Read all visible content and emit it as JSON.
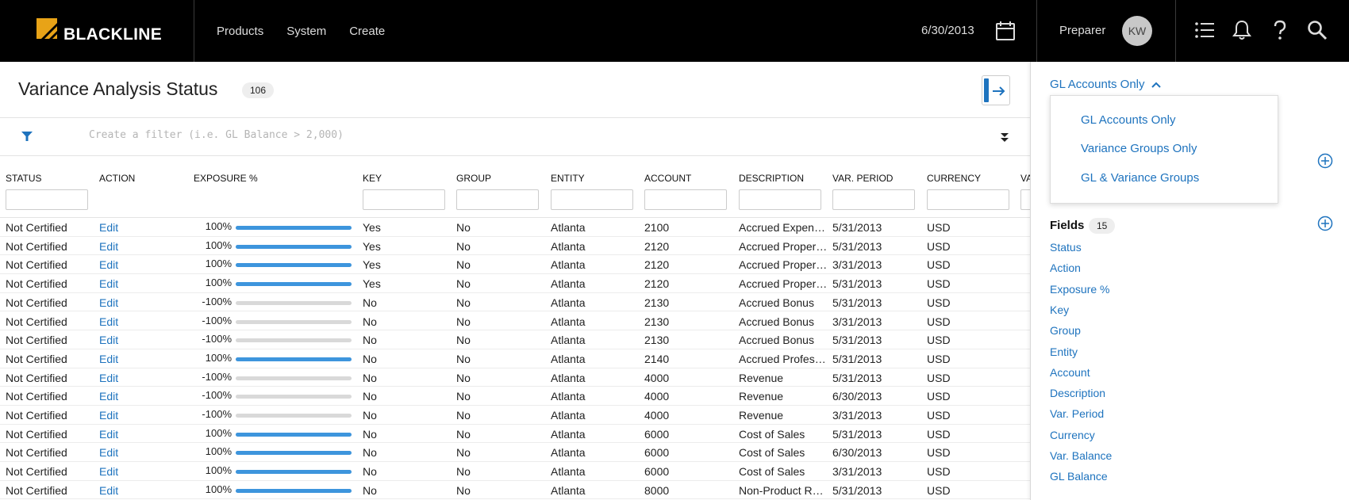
{
  "app": {
    "brand": "BLACKLINE",
    "accent": "#1e73be",
    "bar_blue": "#3d95dd",
    "logo_gold": "#e8a317"
  },
  "nav": {
    "items": [
      "Products",
      "System",
      "Create"
    ]
  },
  "header": {
    "period_date": "6/30/2013",
    "role": "Preparer",
    "avatar_initials": "KW"
  },
  "page": {
    "title": "Variance Analysis Status",
    "count": "106"
  },
  "filter": {
    "placeholder": "Create a filter (i.e. GL Balance > 2,000)"
  },
  "columns": [
    "STATUS",
    "ACTION",
    "EXPOSURE %",
    "KEY",
    "GROUP",
    "ENTITY",
    "ACCOUNT",
    "DESCRIPTION",
    "VAR. PERIOD",
    "CURRENCY",
    "VA"
  ],
  "rows": [
    {
      "status": "Not Certified",
      "action": "Edit",
      "exposure": "100%",
      "fill": 1,
      "key": "Yes",
      "group": "No",
      "entity": "Atlanta",
      "account": "2100",
      "description": "Accrued Expenses",
      "period": "5/31/2013",
      "currency": "USD"
    },
    {
      "status": "Not Certified",
      "action": "Edit",
      "exposure": "100%",
      "fill": 1,
      "key": "Yes",
      "group": "No",
      "entity": "Atlanta",
      "account": "2120",
      "description": "Accrued Property Tax",
      "period": "5/31/2013",
      "currency": "USD"
    },
    {
      "status": "Not Certified",
      "action": "Edit",
      "exposure": "100%",
      "fill": 1,
      "key": "Yes",
      "group": "No",
      "entity": "Atlanta",
      "account": "2120",
      "description": "Accrued Property Tax",
      "period": "3/31/2013",
      "currency": "USD"
    },
    {
      "status": "Not Certified",
      "action": "Edit",
      "exposure": "100%",
      "fill": 1,
      "key": "Yes",
      "group": "No",
      "entity": "Atlanta",
      "account": "2120",
      "description": "Accrued Property Tax",
      "period": "5/31/2013",
      "currency": "USD"
    },
    {
      "status": "Not Certified",
      "action": "Edit",
      "exposure": "-100%",
      "fill": 0,
      "key": "No",
      "group": "No",
      "entity": "Atlanta",
      "account": "2130",
      "description": "Accrued Bonus",
      "period": "5/31/2013",
      "currency": "USD"
    },
    {
      "status": "Not Certified",
      "action": "Edit",
      "exposure": "-100%",
      "fill": 0,
      "key": "No",
      "group": "No",
      "entity": "Atlanta",
      "account": "2130",
      "description": "Accrued Bonus",
      "period": "3/31/2013",
      "currency": "USD"
    },
    {
      "status": "Not Certified",
      "action": "Edit",
      "exposure": "-100%",
      "fill": 0,
      "key": "No",
      "group": "No",
      "entity": "Atlanta",
      "account": "2130",
      "description": "Accrued Bonus",
      "period": "5/31/2013",
      "currency": "USD"
    },
    {
      "status": "Not Certified",
      "action": "Edit",
      "exposure": "100%",
      "fill": 1,
      "key": "No",
      "group": "No",
      "entity": "Atlanta",
      "account": "2140",
      "description": "Accrued Professional Fees",
      "period": "5/31/2013",
      "currency": "USD"
    },
    {
      "status": "Not Certified",
      "action": "Edit",
      "exposure": "-100%",
      "fill": 0,
      "key": "No",
      "group": "No",
      "entity": "Atlanta",
      "account": "4000",
      "description": "Revenue",
      "period": "5/31/2013",
      "currency": "USD"
    },
    {
      "status": "Not Certified",
      "action": "Edit",
      "exposure": "-100%",
      "fill": 0,
      "key": "No",
      "group": "No",
      "entity": "Atlanta",
      "account": "4000",
      "description": "Revenue",
      "period": "6/30/2013",
      "currency": "USD"
    },
    {
      "status": "Not Certified",
      "action": "Edit",
      "exposure": "-100%",
      "fill": 0,
      "key": "No",
      "group": "No",
      "entity": "Atlanta",
      "account": "4000",
      "description": "Revenue",
      "period": "3/31/2013",
      "currency": "USD"
    },
    {
      "status": "Not Certified",
      "action": "Edit",
      "exposure": "100%",
      "fill": 1,
      "key": "No",
      "group": "No",
      "entity": "Atlanta",
      "account": "6000",
      "description": "Cost of Sales",
      "period": "5/31/2013",
      "currency": "USD"
    },
    {
      "status": "Not Certified",
      "action": "Edit",
      "exposure": "100%",
      "fill": 1,
      "key": "No",
      "group": "No",
      "entity": "Atlanta",
      "account": "6000",
      "description": "Cost of Sales",
      "period": "6/30/2013",
      "currency": "USD"
    },
    {
      "status": "Not Certified",
      "action": "Edit",
      "exposure": "100%",
      "fill": 1,
      "key": "No",
      "group": "No",
      "entity": "Atlanta",
      "account": "6000",
      "description": "Cost of Sales",
      "period": "3/31/2013",
      "currency": "USD"
    },
    {
      "status": "Not Certified",
      "action": "Edit",
      "exposure": "100%",
      "fill": 1,
      "key": "No",
      "group": "No",
      "entity": "Atlanta",
      "account": "8000",
      "description": "Non-Product Revenue",
      "period": "5/31/2013",
      "currency": "USD"
    }
  ],
  "sidepanel": {
    "selected": "GL Accounts Only",
    "options": [
      "GL Accounts Only",
      "Variance Groups Only",
      "GL & Variance Groups"
    ],
    "fields_title": "Fields",
    "fields_count": "15",
    "fields": [
      "Status",
      "Action",
      "Exposure %",
      "Key",
      "Group",
      "Entity",
      "Account",
      "Description",
      "Var. Period",
      "Currency",
      "Var. Balance",
      "GL Balance"
    ]
  }
}
